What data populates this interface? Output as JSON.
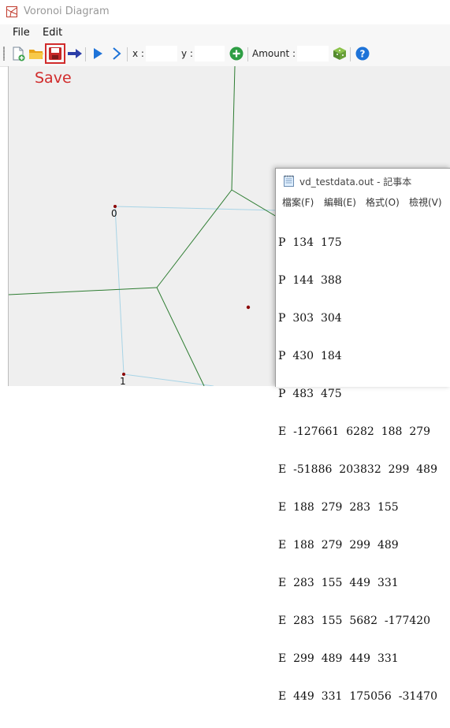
{
  "window": {
    "title": "Voronoi Diagram",
    "icon": "voronoi-app-icon"
  },
  "menu": {
    "items": [
      "File",
      "Edit"
    ]
  },
  "toolbar": {
    "x_label": "x :",
    "x_value": "",
    "y_label": "y :",
    "y_value": "",
    "amount_label": "Amount :",
    "amount_value": "",
    "buttons": [
      "new-file-icon",
      "open-folder-icon",
      "save-icon",
      "next-arrow-icon",
      "play-icon",
      "step-icon",
      "add-icon",
      "random-cube-icon",
      "help-icon"
    ]
  },
  "annotation": {
    "text": "Save",
    "color": "#d12b2b"
  },
  "diagram": {
    "point_labels": [
      "0",
      "1"
    ],
    "edge_color": "#2e7d32",
    "delaunay_color": "#a8d4e6",
    "point_color": "#8b0000"
  },
  "notepad": {
    "title": "vd_testdata.out - 記事本",
    "menu": [
      "檔案(F)",
      "編輯(E)",
      "格式(O)",
      "檢視(V)"
    ],
    "lines": [
      "P  134  175",
      "P  144  388",
      "P  303  304",
      "P  430  184",
      "P  483  475",
      "E  -127661  6282  188  279",
      "E  -51886  203832  299  489",
      "E  188  279  283  155",
      "E  188  279  299  489",
      "E  283  155  449  331",
      "E  283  155  5682  -177420",
      "E  299  489  449  331",
      "E  449  331  175056  -31470"
    ]
  }
}
